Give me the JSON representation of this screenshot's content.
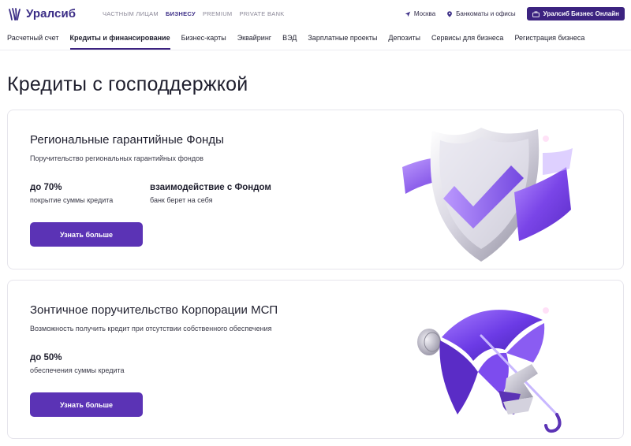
{
  "header": {
    "logo_text": "Уралсиб",
    "segments": [
      {
        "label": "ЧАСТНЫМ ЛИЦАМ",
        "active": false
      },
      {
        "label": "БИЗНЕСУ",
        "active": true
      },
      {
        "label": "PREMIUM",
        "active": false
      },
      {
        "label": "PRIVATE BANK",
        "active": false
      }
    ],
    "city": "Москва",
    "offices": "Банкоматы и офисы",
    "online_button": "Уралсиб Бизнес Онлайн"
  },
  "nav": [
    {
      "label": "Расчетный счет",
      "active": false
    },
    {
      "label": "Кредиты и финансирование",
      "active": true
    },
    {
      "label": "Бизнес-карты",
      "active": false
    },
    {
      "label": "Эквайринг",
      "active": false
    },
    {
      "label": "ВЭД",
      "active": false
    },
    {
      "label": "Зарплатные проекты",
      "active": false
    },
    {
      "label": "Депозиты",
      "active": false
    },
    {
      "label": "Сервисы для бизнеса",
      "active": false
    },
    {
      "label": "Регистрация бизнеса",
      "active": false
    }
  ],
  "page_title": "Кредиты с господдержкой",
  "cards": [
    {
      "title": "Региональные гарантийные Фонды",
      "description": "Поручительство региональных гарантийных фондов",
      "stats": [
        {
          "value": "до 70%",
          "label": "покрытие суммы кредита"
        },
        {
          "value": "взаимодействие с Фондом",
          "label": "банк берет на себя"
        }
      ],
      "button": "Узнать больше"
    },
    {
      "title": "Зонтичное поручительство Корпорации МСП",
      "description": "Возможность получить кредит при отсутствии собственного обеспечения",
      "stats": [
        {
          "value": "до 50%",
          "label": "обеспечения суммы кредита"
        }
      ],
      "button": "Узнать больше"
    }
  ],
  "colors": {
    "brand_dark": "#3c2380",
    "button": "#5b33b5",
    "accent_violet": "#7a45e8"
  },
  "icons": [
    "logo-icon",
    "location-pin-icon",
    "map-marker-icon",
    "briefcase-icon",
    "shield-check-illustration",
    "umbrella-illustration"
  ]
}
